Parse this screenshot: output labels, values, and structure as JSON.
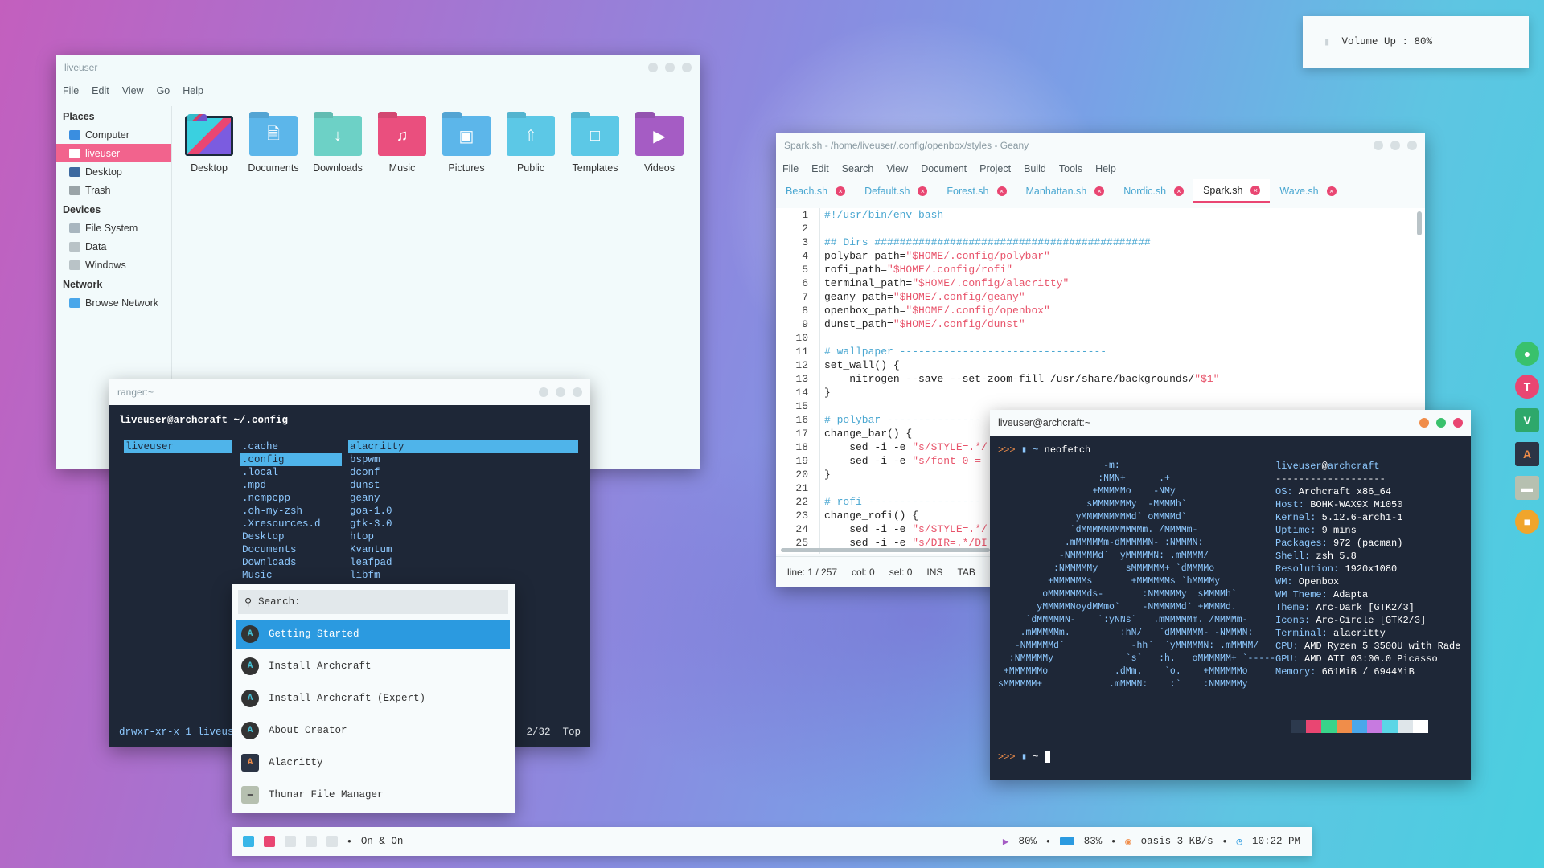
{
  "thunar": {
    "title": "liveuser",
    "menu": [
      "File",
      "Edit",
      "View",
      "Go",
      "Help"
    ],
    "sidebar": {
      "places_label": "Places",
      "places": [
        "Computer",
        "liveuser",
        "Desktop",
        "Trash"
      ],
      "devices_label": "Devices",
      "devices": [
        "File System",
        "Data",
        "Windows"
      ],
      "network_label": "Network",
      "network": [
        "Browse Network"
      ]
    },
    "files": [
      "Desktop",
      "Documents",
      "Downloads",
      "Music",
      "Pictures",
      "Public",
      "Templates",
      "Videos"
    ],
    "colors": {
      "active": "#f2638d",
      "folder_blue": "#5cb6ea",
      "folder_teal": "#6dd1c6",
      "folder_pink": "#ea4f7e",
      "folder_purple": "#a55cc4"
    }
  },
  "geany": {
    "title": "Spark.sh - /home/liveuser/.config/openbox/styles - Geany",
    "menu": [
      "File",
      "Edit",
      "Search",
      "View",
      "Document",
      "Project",
      "Build",
      "Tools",
      "Help"
    ],
    "tabs": [
      "Beach.sh",
      "Default.sh",
      "Forest.sh",
      "Manhattan.sh",
      "Nordic.sh",
      "Spark.sh",
      "Wave.sh"
    ],
    "active_tab": "Spark.sh",
    "line_numbers": [
      "1",
      "2",
      "3",
      "4",
      "5",
      "6",
      "7",
      "8",
      "9",
      "10",
      "11",
      "12",
      "13",
      "14",
      "15",
      "16",
      "17",
      "18",
      "19",
      "20",
      "21",
      "22",
      "23",
      "24",
      "25"
    ],
    "code": [
      {
        "t": "#!/usr/bin/env bash",
        "c": "c-com"
      },
      {
        "t": "",
        "c": ""
      },
      {
        "t": "## Dirs ############################################",
        "c": "c-com"
      },
      {
        "t": "polybar_path=\"$HOME/.config/polybar\"",
        "c": ""
      },
      {
        "t": "rofi_path=\"$HOME/.config/rofi\"",
        "c": ""
      },
      {
        "t": "terminal_path=\"$HOME/.config/alacritty\"",
        "c": ""
      },
      {
        "t": "geany_path=\"$HOME/.config/geany\"",
        "c": ""
      },
      {
        "t": "openbox_path=\"$HOME/.config/openbox\"",
        "c": ""
      },
      {
        "t": "dunst_path=\"$HOME/.config/dunst\"",
        "c": ""
      },
      {
        "t": "",
        "c": ""
      },
      {
        "t": "# wallpaper ---------------------------------",
        "c": "c-com"
      },
      {
        "t": "set_wall() {",
        "c": ""
      },
      {
        "t": "    nitrogen --save --set-zoom-fill /usr/share/backgrounds/\"$1\"",
        "c": ""
      },
      {
        "t": "}",
        "c": ""
      },
      {
        "t": "",
        "c": ""
      },
      {
        "t": "# polybar ---------------",
        "c": "c-com"
      },
      {
        "t": "change_bar() {",
        "c": ""
      },
      {
        "t": "    sed -i -e \"s/STYLE=.*/",
        "c": ""
      },
      {
        "t": "    sed -i -e \"s/font-0 =",
        "c": ""
      },
      {
        "t": "}",
        "c": ""
      },
      {
        "t": "",
        "c": ""
      },
      {
        "t": "# rofi ------------------",
        "c": "c-com"
      },
      {
        "t": "change_rofi() {",
        "c": ""
      },
      {
        "t": "    sed -i -e \"s/STYLE=.*/",
        "c": ""
      },
      {
        "t": "    sed -i -e \"s/DIR=.*/DI",
        "c": ""
      }
    ],
    "status": {
      "line": "line: 1 / 257",
      "col": "col: 0",
      "sel": "sel: 0",
      "mode": "INS",
      "indent": "TAB"
    }
  },
  "ranger": {
    "title": "ranger:~",
    "header_user": "liveuser@archcraft",
    "header_path": " ~/.config",
    "col1": [
      "liveuser"
    ],
    "col2": [
      ".cache",
      ".config",
      ".local",
      ".mpd",
      ".ncmpcpp",
      ".oh-my-zsh",
      ".Xresources.d",
      "Desktop",
      "Documents",
      "Downloads",
      "Music"
    ],
    "col3": [
      "alacritty",
      "bspwm",
      "dconf",
      "dunst",
      "geany",
      "goa-1.0",
      "gtk-3.0",
      "htop",
      "Kvantum",
      "leafpad",
      "libfm"
    ],
    "footer_left": "drwxr-xr-x 1 liveuse",
    "footer_right_e": "e",
    "footer_pos": "2/32",
    "footer_top": "Top"
  },
  "rofi": {
    "search_placeholder": "Search:",
    "items": [
      "Getting Started",
      "Install Archcraft",
      "Install Archcraft (Expert)",
      "About Creator",
      "Alacritty",
      "Thunar File Manager"
    ]
  },
  "terminal": {
    "title": "liveuser@archcraft:~",
    "prompt": ">>> ",
    "command": "neofetch",
    "ascii": [
      "                   -m:",
      "                  :NMN+      .+",
      "                 +MMMMMo    -NMy",
      "                sMMMMMMMy  -MMMMh`",
      "              yMMMMMMMMMd` oMMMMd`",
      "             `dMMMMMMMMMMMm. /MMMMm-",
      "            .mMMMMMm-dMMMMMN- :NMMMN:",
      "           -NMMMMMd`  yMMMMMN: .mMMMM/",
      "          :NMMMMMy     sMMMMMM+ `dMMMMo",
      "         +MMMMMMs       +MMMMMMs `hMMMMy",
      "        oMMMMMMMds-       :NMMMMMy  sMMMMh`",
      "       yMMMMMNoydMMmo`    -NMMMMMd` +MMMMd.",
      "     `dMMMMMN-    `:yNNs`   .mMMMMMm. /MMMMm-",
      "    .mMMMMMm.         :hN/   `dMMMMMM- -NMMMN:",
      "   -NMMMMMd`            -hh`  `yMMMMMN: .mMMMM/",
      "  :NMMMMMy             `s`   :h.   oMMMMMM+ `-----",
      " +MMMMMMo            .dMm.    `o.    +MMMMMMo",
      "sMMMMMM+            .mMMMN:    :`    :NMMMMMy"
    ],
    "info_user": "liveuser",
    "info_host": "archcraft",
    "info_sep": "-------------------",
    "info": [
      {
        "k": "OS:",
        "v": " Archcraft x86_64"
      },
      {
        "k": "Host:",
        "v": " BOHK-WAX9X M1050"
      },
      {
        "k": "Kernel:",
        "v": " 5.12.6-arch1-1"
      },
      {
        "k": "Uptime:",
        "v": " 9 mins"
      },
      {
        "k": "Packages:",
        "v": " 972 (pacman)"
      },
      {
        "k": "Shell:",
        "v": " zsh 5.8"
      },
      {
        "k": "Resolution:",
        "v": " 1920x1080"
      },
      {
        "k": "WM:",
        "v": " Openbox"
      },
      {
        "k": "WM Theme:",
        "v": " Adapta"
      },
      {
        "k": "Theme:",
        "v": " Arc-Dark [GTK2/3]"
      },
      {
        "k": "Icons:",
        "v": " Arc-Circle [GTK2/3]"
      },
      {
        "k": "Terminal:",
        "v": " alacritty"
      },
      {
        "k": "CPU:",
        "v": " AMD Ryzen 5 3500U with Rade"
      },
      {
        "k": "GPU:",
        "v": " AMD ATI 03:00.0 Picasso"
      },
      {
        "k": "Memory:",
        "v": " 661MiB / 6944MiB"
      }
    ],
    "palette": [
      "#1e2737",
      "#2d3a4e",
      "#e94672",
      "#39d48a",
      "#f08d4a",
      "#4aa7ea",
      "#c77ae0",
      "#5bd6e6",
      "#dfe6ea",
      "#ffffff"
    ],
    "prompt2": ">>> ",
    "path2": "~"
  },
  "notification": {
    "text": "Volume Up : 80%"
  },
  "panel": {
    "ws_colors": [
      "#39b6e8",
      "#e94672",
      "#dde3e6",
      "#dde3e6",
      "#dde3e6"
    ],
    "title": "On & On",
    "volume": "80%",
    "battery": "83%",
    "network": "oasis 3 KB/s",
    "time": "10:22 PM"
  }
}
